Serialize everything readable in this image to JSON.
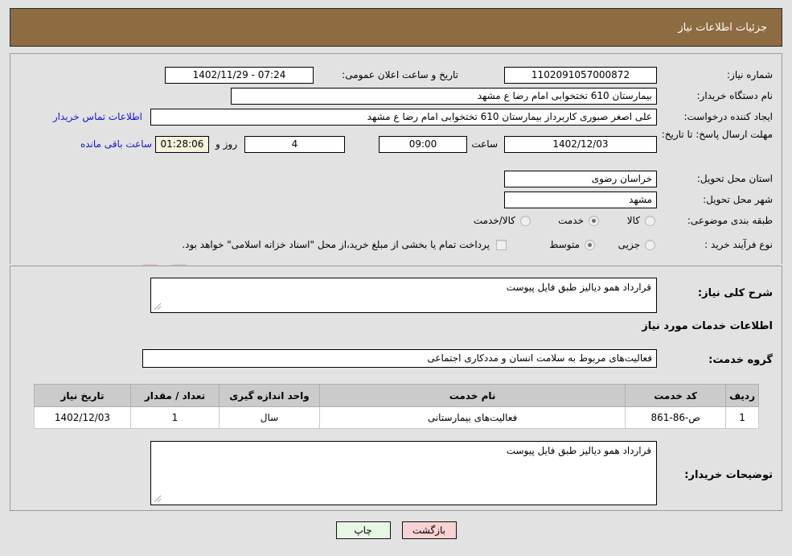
{
  "header": {
    "title": "جزئیات اطلاعات نیاز"
  },
  "form": {
    "need_number_label": "شماره نیاز:",
    "need_number_value": "1102091057000872",
    "announce_datetime_label": "تاریخ و ساعت اعلان عمومی:",
    "announce_datetime_value": "07:24 - 1402/11/29",
    "buyer_org_label": "نام دستگاه خریدار:",
    "buyer_org_value": "بیمارستان 610 تختخوابی امام رضا ع  مشهد",
    "creator_label": "ایجاد کننده درخواست:",
    "creator_value": "علی اصغر صبوری کاربرداز بیمارستان 610 تختخوابی امام رضا ع  مشهد",
    "contact_link_label": "اطلاعات تماس خریدار",
    "deadline_label": "مهلت ارسال پاسخ: تا تاریخ:",
    "deadline_date": "1402/12/03",
    "time_label": "ساعت",
    "deadline_time": "09:00",
    "days_remaining": "4",
    "days_and_label": "روز و",
    "hours_remaining": "01:28:06",
    "hours_remaining_label": "ساعت باقی مانده",
    "province_label": "استان محل تحویل:",
    "province_value": "خراسان رضوی",
    "city_label": "شهر محل تحویل:",
    "city_value": "مشهد",
    "category_label": "طبقه بندی موضوعی:",
    "category_options": [
      {
        "label": "کالا",
        "selected": false
      },
      {
        "label": "خدمت",
        "selected": true
      },
      {
        "label": "کالا/خدمت",
        "selected": false
      }
    ],
    "process_label": "نوع فرآیند خرید :",
    "process_options": [
      {
        "label": "جزیی",
        "selected": false
      },
      {
        "label": "متوسط",
        "selected": true
      }
    ],
    "treasury_note": "پرداخت تمام یا بخشی از مبلغ خرید،از محل \"اسناد خزانه اسلامی\" خواهد بود."
  },
  "description": {
    "label": "شرح کلی نیاز:",
    "value": "قرارداد همو دیالیز طبق فایل پیوست"
  },
  "services_section": {
    "heading": "اطلاعات خدمات مورد نیاز",
    "group_label": "گروه خدمت:",
    "group_value": "فعالیت‌های مربوط به سلامت انسان و مددکاری اجتماعی"
  },
  "table": {
    "columns": [
      "ردیف",
      "کد خدمت",
      "نام خدمت",
      "واحد اندازه گیری",
      "تعداد / مقدار",
      "تاریخ نیاز"
    ],
    "rows": [
      {
        "row": "1",
        "code": "ص-86-861",
        "name": "فعالیت‌های بیمارستانی",
        "unit": "سال",
        "quantity": "1",
        "need_date": "1402/12/03"
      }
    ]
  },
  "buyer_comments": {
    "label": "توضیحات خریدار:",
    "value": "قرارداد همو دیالیز طبق فایل پیوست"
  },
  "buttons": {
    "print": "چاپ",
    "back": "بازگشت"
  },
  "watermark": {
    "text": "AriaTender.net"
  }
}
